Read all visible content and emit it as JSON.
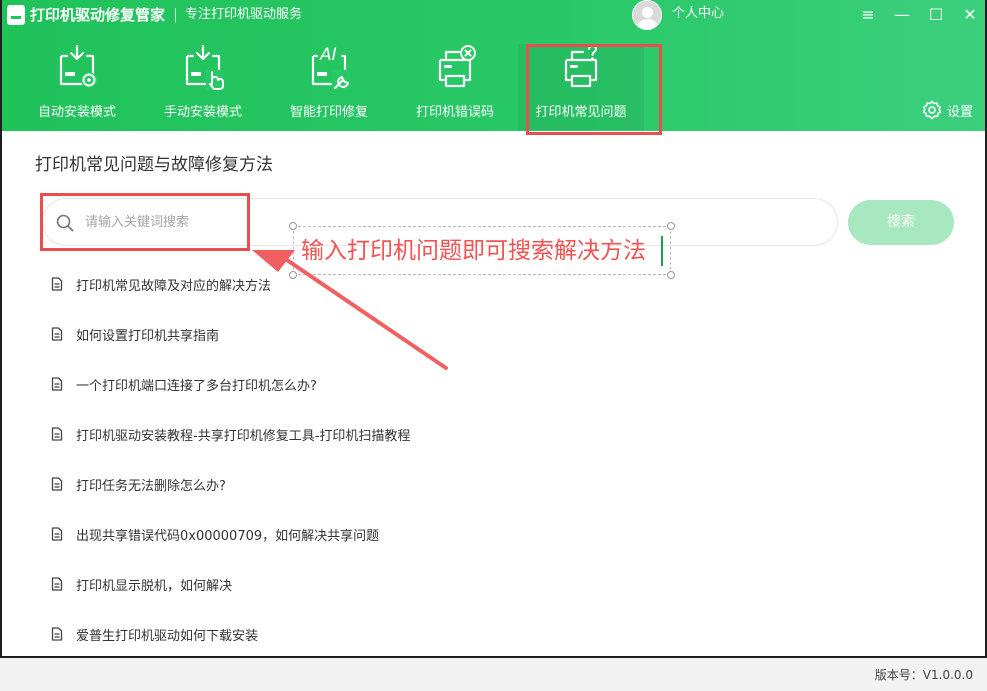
{
  "app": {
    "title": "打印机驱动修复管家",
    "subtitle": "专注打印机驱动服务",
    "user_center": "个人中心"
  },
  "window_controls": {
    "menu": "≡",
    "minimize": "—",
    "maximize": "☐",
    "close": "✕"
  },
  "nav": {
    "items": [
      {
        "label": "自动安装模式",
        "icon": "auto-install-icon"
      },
      {
        "label": "手动安装模式",
        "icon": "manual-install-icon"
      },
      {
        "label": "智能打印修复",
        "icon": "ai-repair-icon"
      },
      {
        "label": "打印机错误码",
        "icon": "printer-error-code-icon"
      },
      {
        "label": "打印机常见问题",
        "icon": "printer-faq-icon",
        "active": true
      }
    ],
    "settings_label": "设置"
  },
  "content": {
    "title": "打印机常见问题与故障修复方法",
    "search": {
      "placeholder": "请输入关键词搜索",
      "button_label": "搜索"
    },
    "faq_items": [
      "打印机常见故障及对应的解决方法",
      "如何设置打印机共享指南",
      "一个打印机端口连接了多台打印机怎么办?",
      "打印机驱动安装教程-共享打印机修复工具-打印机扫描教程",
      "打印任务无法删除怎么办?",
      "出现共享错误代码0x00000709，如何解决共享问题",
      "打印机显示脱机，如何解决",
      "爱普生打印机驱动如何下载安装"
    ]
  },
  "annotation": {
    "text": "输入打印机问题即可搜索解决方法",
    "color": "#f25353"
  },
  "footer": {
    "version": "版本号：V1.0.0.0"
  },
  "colors": {
    "brand_green": "#20c25a",
    "search_button": "#a8e8c0",
    "highlight_red": "#e94f4f"
  }
}
